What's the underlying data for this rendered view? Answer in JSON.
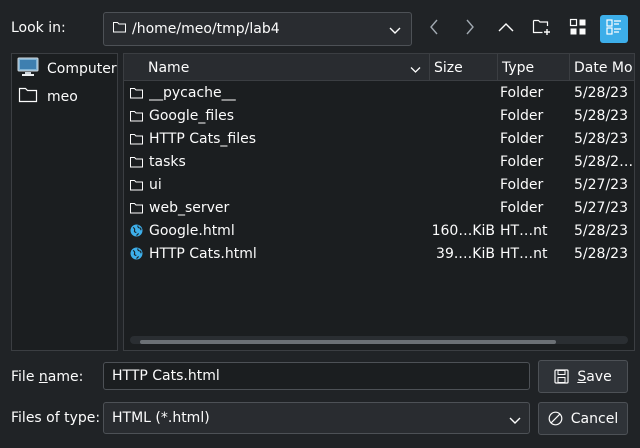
{
  "toolbar": {
    "look_in_label": "Look in:",
    "path": "/home/meo/tmp/lab4"
  },
  "places": [
    {
      "label": "Computer",
      "icon": "computer-icon"
    },
    {
      "label": "meo",
      "icon": "folder-icon"
    }
  ],
  "columns": [
    "Name",
    "Size",
    "Type",
    "Date Mo"
  ],
  "files": [
    {
      "name": "__pycache__",
      "size": "",
      "type": "Folder",
      "date": "5/28/23",
      "icon": "folder-icon"
    },
    {
      "name": "Google_files",
      "size": "",
      "type": "Folder",
      "date": "5/28/23",
      "icon": "folder-icon"
    },
    {
      "name": "HTTP Cats_files",
      "size": "",
      "type": "Folder",
      "date": "5/28/23",
      "icon": "folder-icon"
    },
    {
      "name": "tasks",
      "size": "",
      "type": "Folder",
      "date": "5/28/2…",
      "icon": "folder-icon"
    },
    {
      "name": "ui",
      "size": "",
      "type": "Folder",
      "date": "5/27/23",
      "icon": "folder-icon"
    },
    {
      "name": "web_server",
      "size": "",
      "type": "Folder",
      "date": "5/27/23",
      "icon": "folder-icon"
    },
    {
      "name": "Google.html",
      "size": "160…KiB",
      "type": "HT…nt",
      "date": "5/28/23",
      "icon": "globe-icon"
    },
    {
      "name": "HTTP Cats.html",
      "size": "39.…KiB",
      "type": "HT…nt",
      "date": "5/28/23",
      "icon": "globe-icon"
    }
  ],
  "filename": {
    "label_pre": "File ",
    "label_u": "n",
    "label_post": "ame:",
    "value": "HTTP Cats.html"
  },
  "filetype": {
    "label": "Files of type:",
    "value": "HTML (*.html)"
  },
  "buttons": {
    "save_u": "S",
    "save_rest": "ave",
    "cancel": "Cancel"
  },
  "colors": {
    "accent": "#3daee9",
    "background": "#202326",
    "view_background": "#1b1e20"
  }
}
